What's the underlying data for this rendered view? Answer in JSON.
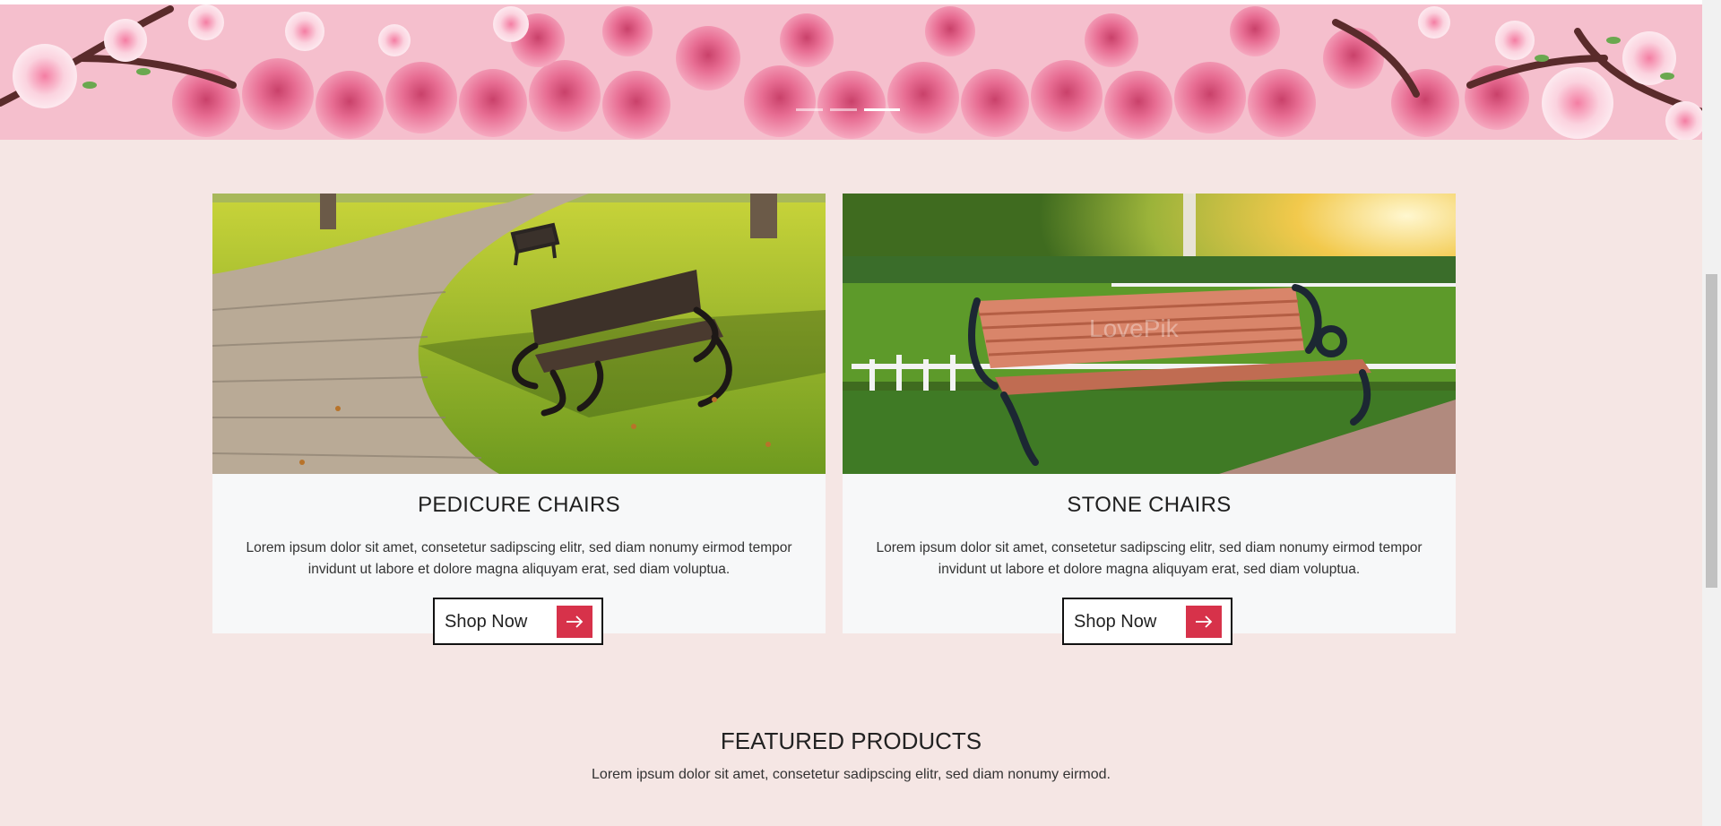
{
  "hero": {
    "slides": 3,
    "active_slide": 3
  },
  "cards": [
    {
      "title": "PEDICURE CHAIRS",
      "description": "Lorem ipsum dolor sit amet, consetetur sadipscing elitr, sed diam nonumy eirmod tempor invidunt ut labore et dolore magna aliquyam erat, sed diam voluptua.",
      "button_label": "Shop Now"
    },
    {
      "title": "STONE CHAIRS",
      "description": "Lorem ipsum dolor sit amet, consetetur sadipscing elitr, sed diam nonumy eirmod tempor invidunt ut labore et dolore magna aliquyam erat, sed diam voluptua.",
      "button_label": "Shop Now",
      "image_watermark": "LovePik"
    }
  ],
  "featured": {
    "title": "FEATURED PRODUCTS",
    "subtitle": "Lorem ipsum dolor sit amet, consetetur sadipscing elitr, sed diam nonumy eirmod."
  },
  "colors": {
    "background": "#f5e6e4",
    "card": "#f7f8f9",
    "accent": "#d7324a"
  },
  "icons": [
    "arrow-right-icon"
  ]
}
